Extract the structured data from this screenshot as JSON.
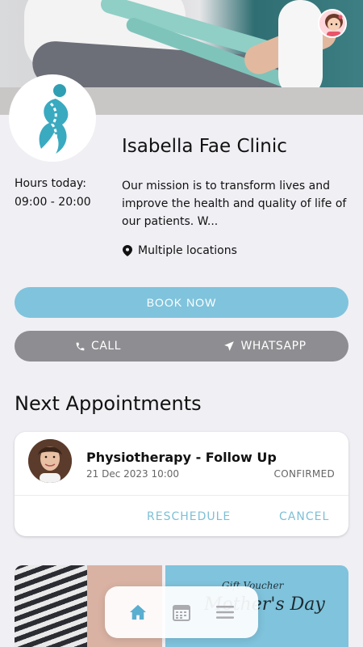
{
  "clinic": {
    "name": "Isabella Fae Clinic",
    "hours_label": "Hours today:",
    "hours_value": "09:00 - 20:00",
    "mission": "Our mission is to transform lives and improve the health and quality of life of our patients. W...",
    "location": "Multiple locations"
  },
  "actions": {
    "book_label": "BOOK NOW",
    "call_label": "CALL",
    "whatsapp_label": "WHATSAPP"
  },
  "appointments": {
    "section_title": "Next Appointments",
    "items": [
      {
        "title": "Physiotherapy - Follow Up",
        "datetime": "21 Dec 2023 10:00",
        "status": "CONFIRMED",
        "reschedule_label": "RESCHEDULE",
        "cancel_label": "CANCEL"
      }
    ]
  },
  "promos": {
    "voucher_line1": "Gift Voucher",
    "voucher_line2": "Mother's Day"
  },
  "nav": {
    "items": [
      "home-icon",
      "calendar-icon",
      "menu-icon"
    ],
    "active": "home-icon"
  },
  "colors": {
    "accent": "#80c3dc",
    "secondary_button": "#8e8e92",
    "link": "#7dbfd6",
    "background": "#f0eff4",
    "logo_teal": "#2f9fb4"
  }
}
